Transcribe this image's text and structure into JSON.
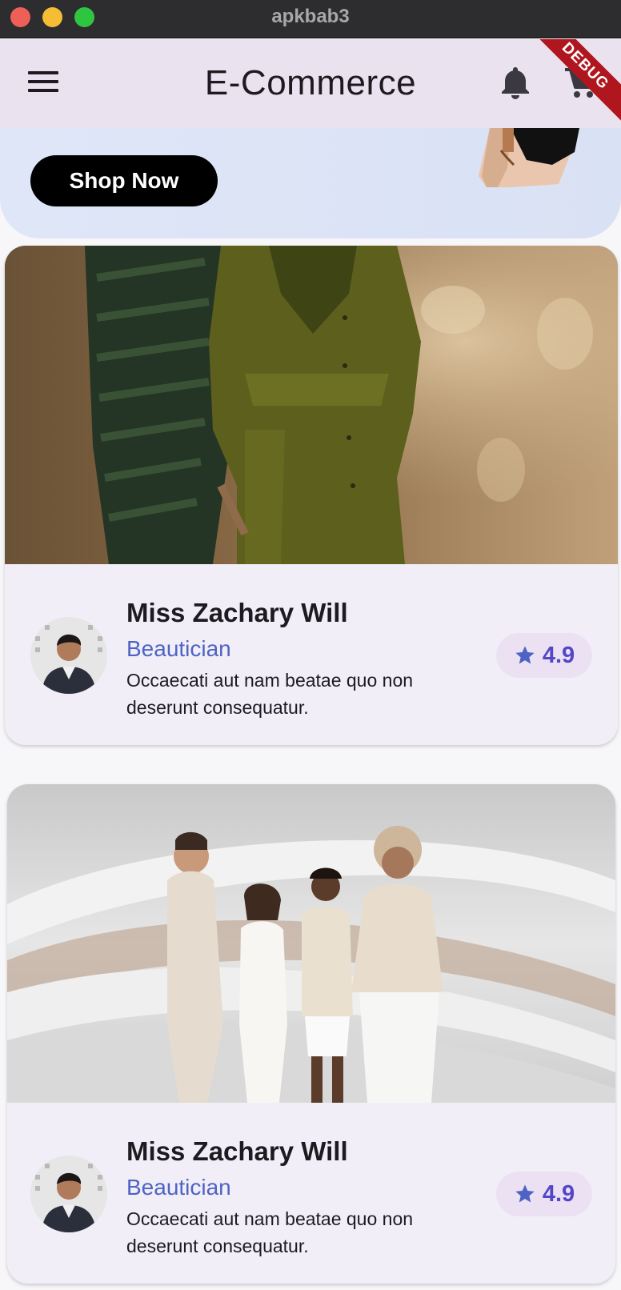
{
  "window": {
    "title": "apkbab3"
  },
  "appbar": {
    "title": "E-Commerce",
    "debug_label": "DEBUG"
  },
  "banner": {
    "button_label": "Shop Now"
  },
  "cards": [
    {
      "name": "Miss Zachary Will",
      "role": "Beautician",
      "description": "Occaecati aut nam beatae quo non deserunt consequatur.",
      "rating": "4.9"
    },
    {
      "name": "Miss Zachary Will",
      "role": "Beautician",
      "description": "Occaecati aut nam beatae quo non deserunt consequatur.",
      "rating": "4.9"
    }
  ],
  "colors": {
    "accent": "#4d64c4",
    "rating": "#5446c7",
    "appbar_bg": "#ebe2ef",
    "card_bg": "#f2eef7"
  },
  "icons": [
    "menu-icon",
    "bell-icon",
    "cart-icon",
    "star-icon"
  ]
}
